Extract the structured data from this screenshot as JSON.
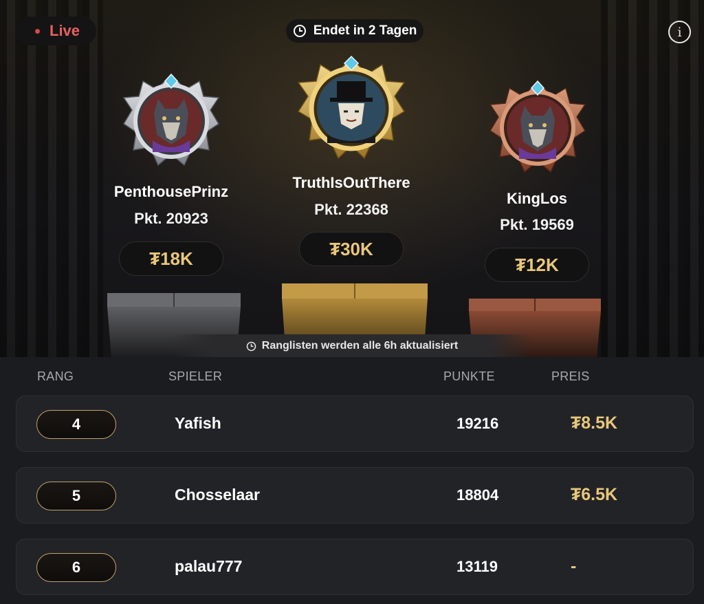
{
  "header": {
    "live_label": "Live",
    "ends_label": "Endet in 2 Tagen",
    "info_icon": "info-icon"
  },
  "podium": [
    {
      "rank": 2,
      "tier": "silver",
      "name": "PenthousePrinz",
      "points": "Pkt. 20923",
      "prize": "₮18K",
      "avatar": "wolf-avatar"
    },
    {
      "rank": 1,
      "tier": "gold",
      "name": "TruthIsOutThere",
      "points": "Pkt. 22368",
      "prize": "₮30K",
      "avatar": "masked-man-avatar"
    },
    {
      "rank": 3,
      "tier": "bronze",
      "name": "KingLos",
      "points": "Pkt. 19569",
      "prize": "₮12K",
      "avatar": "wolf-avatar"
    }
  ],
  "notice": "Ranglisten werden alle 6h aktualisiert",
  "table": {
    "headers": {
      "rank": "RANG",
      "player": "SPIELER",
      "points": "PUNKTE",
      "prize": "PREIS"
    },
    "rows": [
      {
        "rank": "4",
        "player": "Yafish",
        "points": "19216",
        "prize": "₮8.5K"
      },
      {
        "rank": "5",
        "player": "Chosselaar",
        "points": "18804",
        "prize": "₮6.5K"
      },
      {
        "rank": "6",
        "player": "palau777",
        "points": "13119",
        "prize": "-"
      }
    ]
  },
  "colors": {
    "gold": "#e8c77a",
    "live_red": "#e86060",
    "silver": "#b9bcc2",
    "bronze": "#b86a4a"
  }
}
